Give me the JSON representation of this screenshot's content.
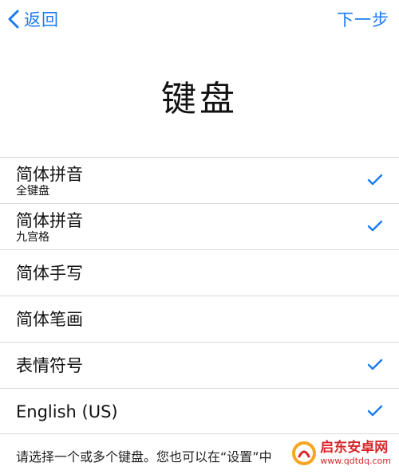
{
  "nav": {
    "back_label": "返回",
    "next_label": "下一步"
  },
  "page": {
    "title": "键盘"
  },
  "keyboards": [
    {
      "title": "简体拼音",
      "subtitle": "全键盘",
      "selected": true
    },
    {
      "title": "简体拼音",
      "subtitle": "九宫格",
      "selected": true
    },
    {
      "title": "简体手写",
      "subtitle": "",
      "selected": false
    },
    {
      "title": "简体笔画",
      "subtitle": "",
      "selected": false
    },
    {
      "title": "表情符号",
      "subtitle": "",
      "selected": true
    },
    {
      "title": "English (US)",
      "subtitle": "",
      "selected": true
    }
  ],
  "footer": {
    "note": "请选择一个或多个键盘。您也可以在“设置”中"
  },
  "watermark": {
    "title": "启东安卓网",
    "url": "www.qdtdq.com"
  },
  "icons": {
    "back": "chevron-left-icon",
    "check": "checkmark-icon",
    "watermark_logo": "watermark-logo-icon"
  },
  "colors": {
    "accent": "#1a7cf0",
    "separator": "#d9d9dc",
    "watermark": "#d8262b"
  }
}
